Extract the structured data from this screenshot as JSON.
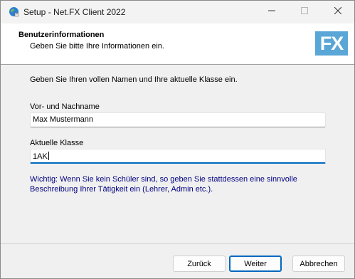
{
  "window": {
    "title": "Setup - Net.FX Client 2022"
  },
  "header": {
    "title": "Benutzerinformationen",
    "subtitle": "Geben Sie bitte Ihre Informationen ein.",
    "logo_text": "FX",
    "logo_color": "#5aa6d6"
  },
  "main": {
    "intro": "Geben Sie Ihren vollen Namen und Ihre aktuelle Klasse ein.",
    "name_label": "Vor- und Nachname",
    "name_value": "Max Mustermann",
    "class_label": "Aktuelle Klasse",
    "class_value": "1AK",
    "hint": "Wichtig: Wenn Sie kein Schüler sind, so geben Sie stattdessen eine sinnvolle Beschreibung Ihrer Tätigkeit ein (Lehrer, Admin etc.).",
    "hint_color": "#000080"
  },
  "buttons": {
    "back_label": "Zurück",
    "next_label": "Weiter",
    "cancel_label": "Abbrechen"
  },
  "icons": {
    "app": "setup-globe-icon",
    "minimize": "minimize-icon",
    "maximize": "maximize-icon",
    "close": "close-icon"
  }
}
